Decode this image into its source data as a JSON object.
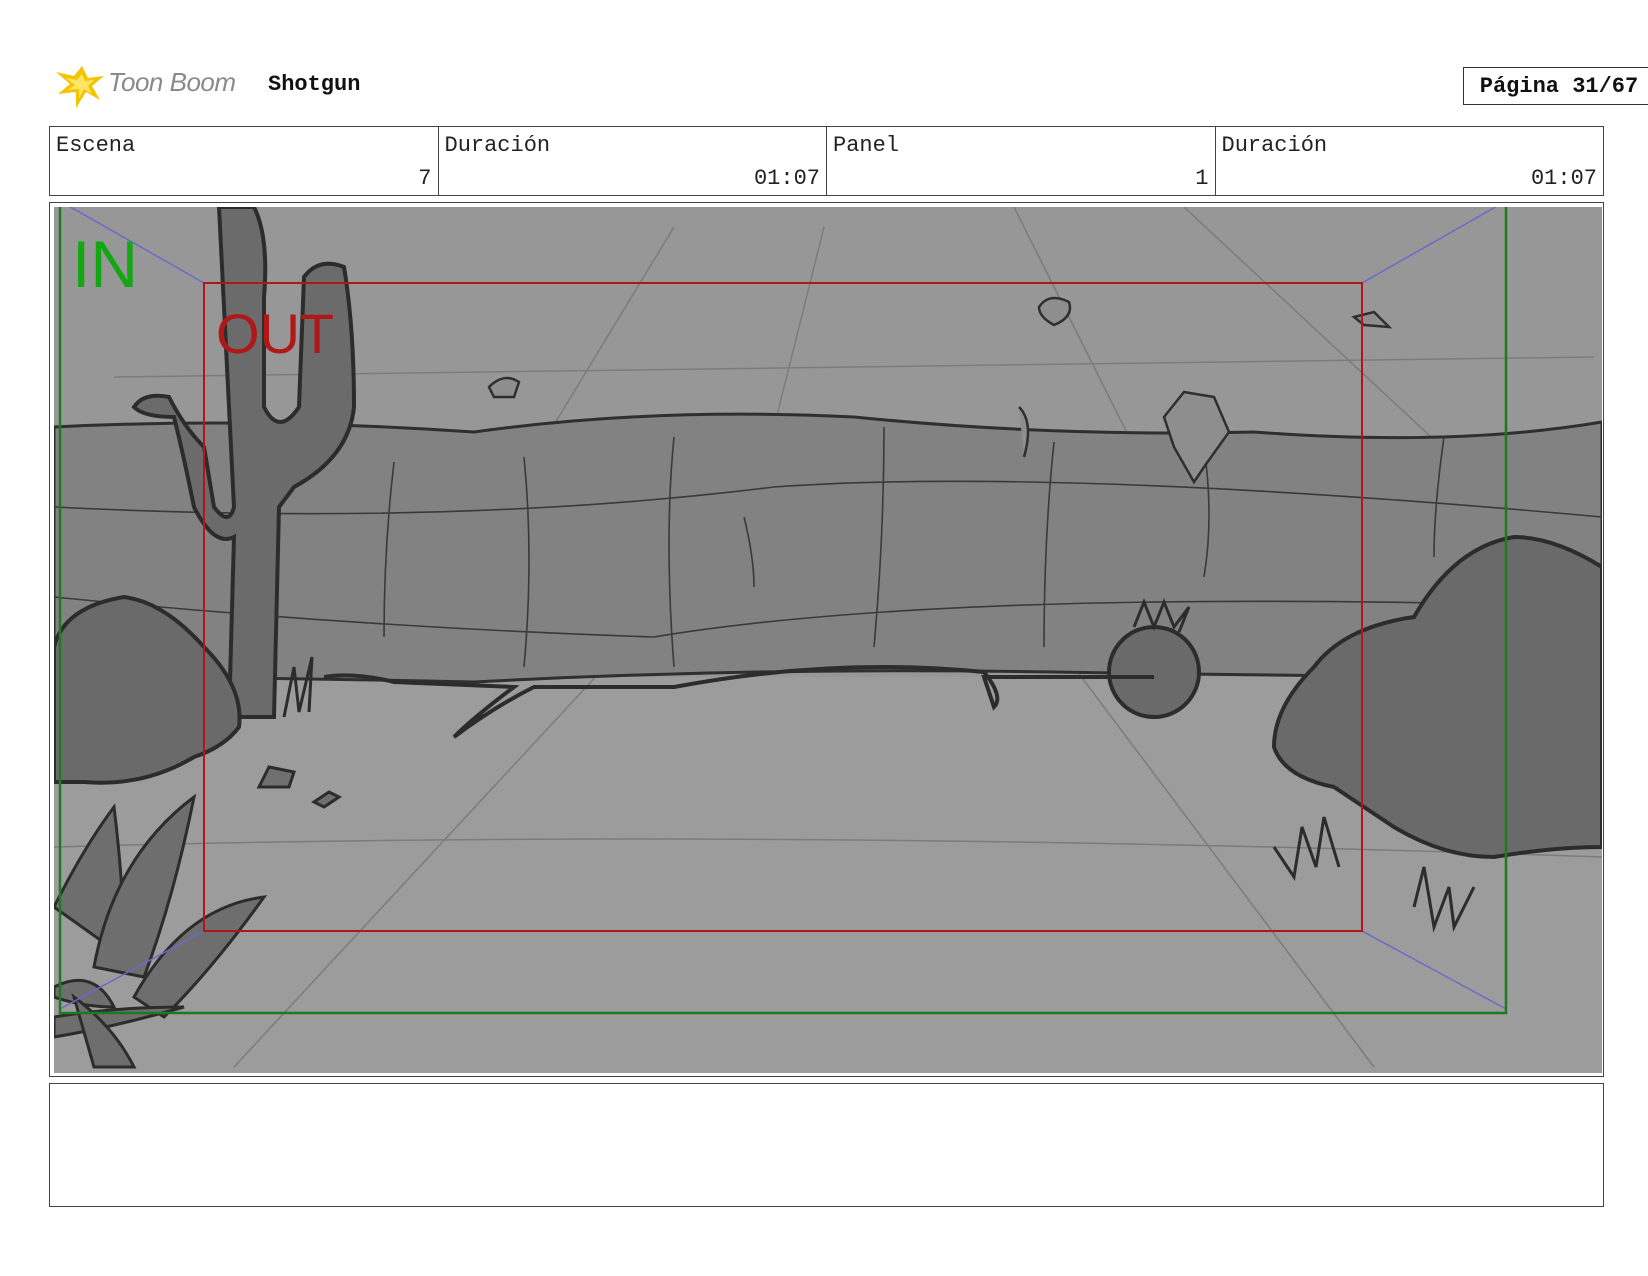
{
  "header": {
    "brand": "Toon Boom",
    "project": "Shotgun",
    "page_label": "Página 31/67"
  },
  "info": {
    "scene_label": "Escena",
    "scene_value": "7",
    "scene_duration_label": "Duración",
    "scene_duration_value": "01:07",
    "panel_label": "Panel",
    "panel_value": "1",
    "panel_duration_label": "Duración",
    "panel_duration_value": "01:07"
  },
  "panel_image": {
    "in_label": "IN",
    "out_label": "OUT",
    "colors": {
      "in_frame": "#1f7a1f",
      "in_text": "#13a813",
      "out_frame": "#b01818",
      "guide_lines": "#6a6acb",
      "sky": "#959595",
      "ground": "#9a9a9a",
      "wall": "#818181",
      "dark_shapes": "#6b6b6b",
      "outline": "#2f2f2f"
    }
  },
  "notes": {
    "text": ""
  }
}
